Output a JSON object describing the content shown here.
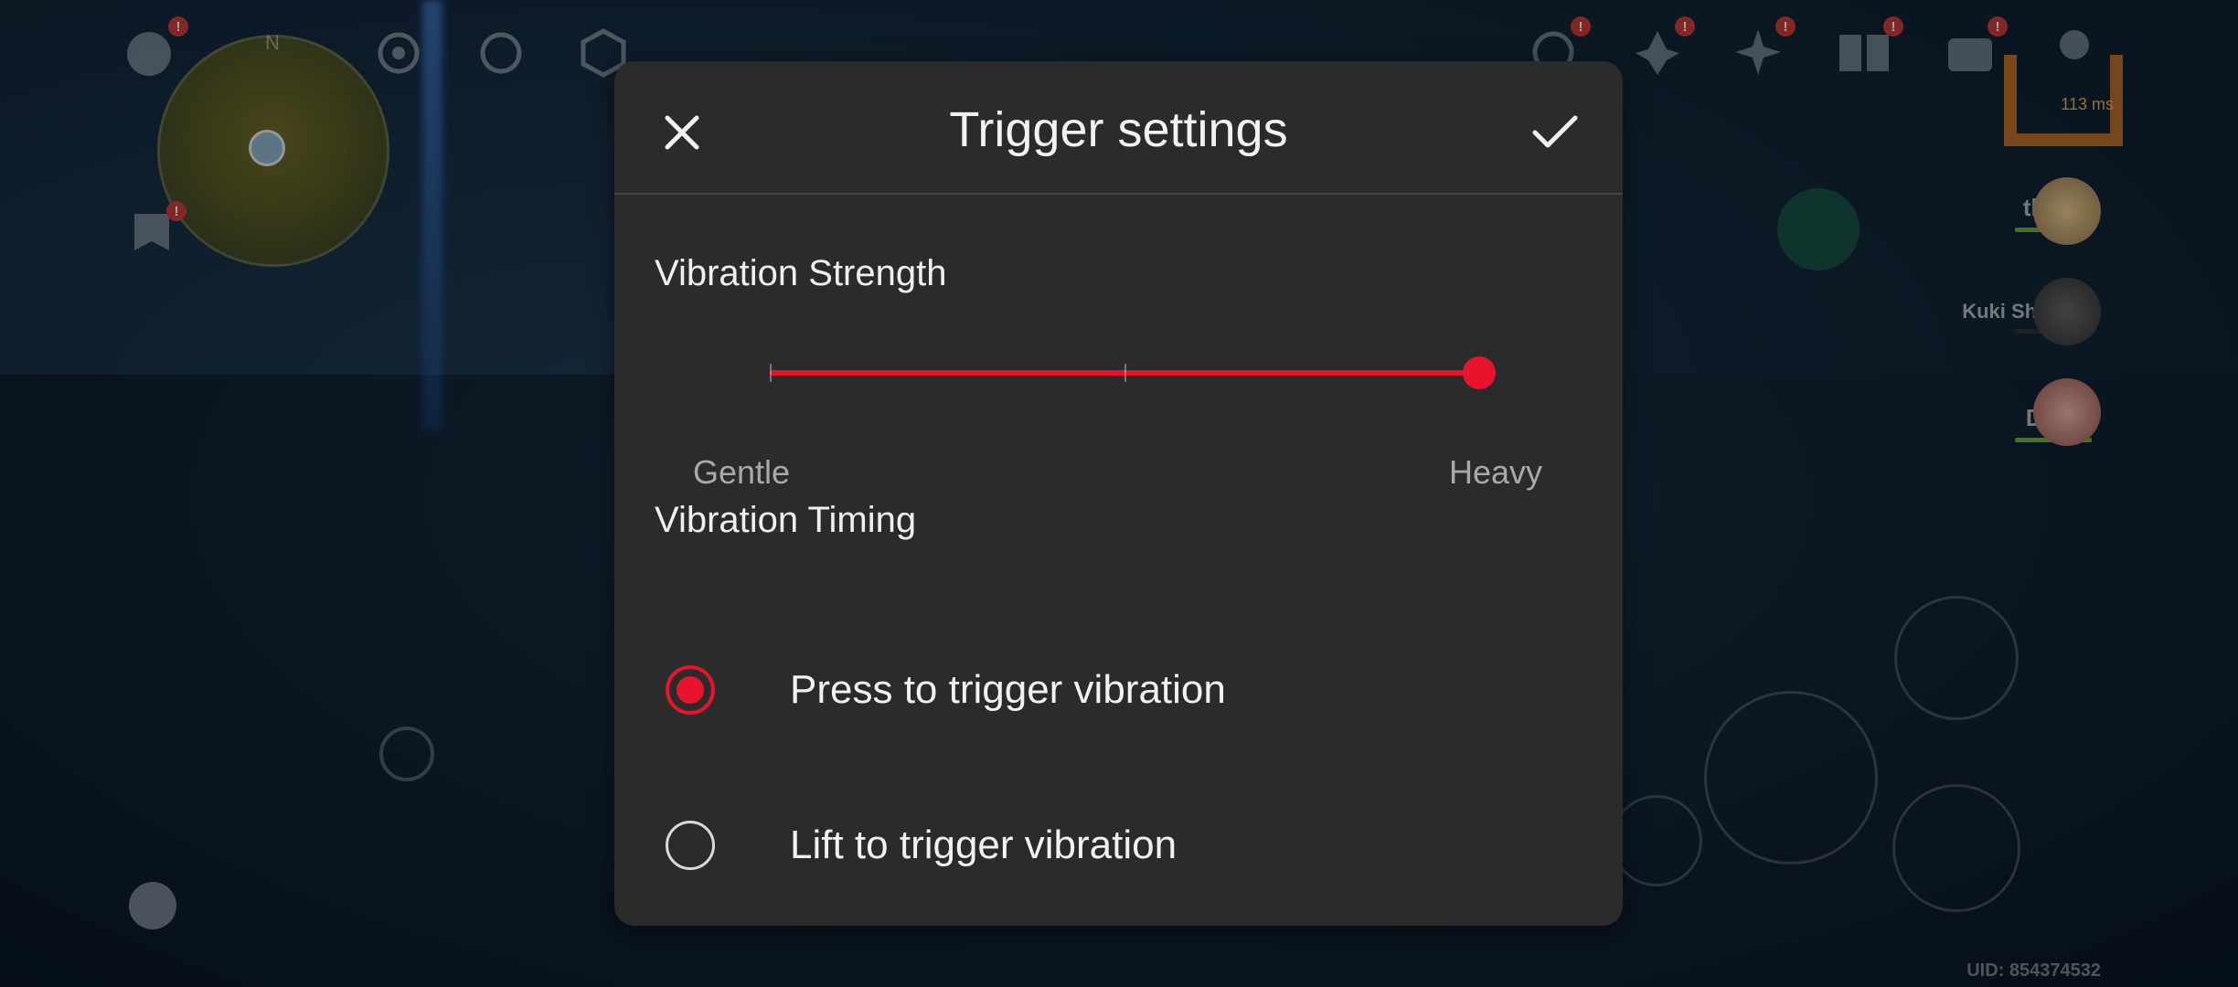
{
  "game": {
    "party": [
      {
        "name": "thesis"
      },
      {
        "name": "Kuki Shinobu"
      },
      {
        "name": "Diona"
      }
    ],
    "uid": "UID: 854374532",
    "ping": "113 ms",
    "minimap_compass": "N",
    "notification_badge": "!"
  },
  "dialog": {
    "title": "Trigger settings",
    "close_icon": "close-icon",
    "confirm_icon": "checkmark-icon",
    "vibration_strength": {
      "label": "Vibration Strength",
      "min_label": "Gentle",
      "max_label": "Heavy",
      "value_fraction": 1.0,
      "steps": 3
    },
    "vibration_timing": {
      "label": "Vibration Timing",
      "options": [
        {
          "label": "Press to trigger vibration",
          "selected": true
        },
        {
          "label": "Lift to trigger vibration",
          "selected": false
        }
      ]
    }
  },
  "colors": {
    "accent": "#e8142d",
    "dialog_bg": "#2b2b2c"
  }
}
